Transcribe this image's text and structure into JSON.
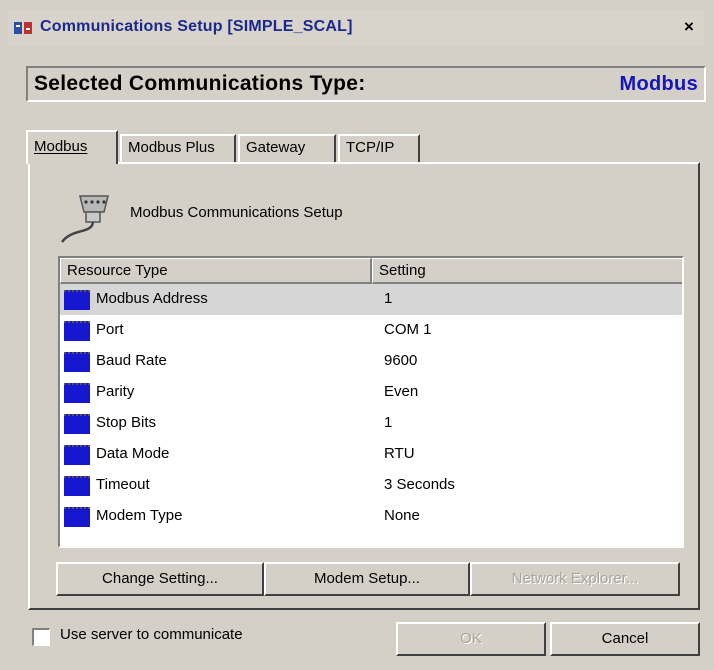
{
  "window": {
    "title": "Communications Setup [SIMPLE_SCAL]",
    "close_glyph": "×"
  },
  "selected_type": {
    "label": "Selected Communications Type:",
    "value": "Modbus",
    "value_color": "#1515b8"
  },
  "tabs": [
    {
      "label": "Modbus",
      "active": true
    },
    {
      "label": "Modbus Plus",
      "active": false
    },
    {
      "label": "Gateway",
      "active": false
    },
    {
      "label": "TCP/IP",
      "active": false
    }
  ],
  "panel": {
    "title": "Modbus Communications Setup",
    "icon": "serial-cable-icon"
  },
  "table": {
    "columns": [
      "Resource Type",
      "Setting"
    ],
    "row_icon": "chip-icon",
    "rows": [
      {
        "name": "Modbus Address",
        "value": "1",
        "selected": true
      },
      {
        "name": "Port",
        "value": "COM 1"
      },
      {
        "name": "Baud Rate",
        "value": "9600"
      },
      {
        "name": "Parity",
        "value": "Even"
      },
      {
        "name": "Stop Bits",
        "value": "1"
      },
      {
        "name": "Data Mode",
        "value": "RTU"
      },
      {
        "name": "Timeout",
        "value": "3 Seconds"
      },
      {
        "name": "Modem Type",
        "value": "None"
      }
    ]
  },
  "panel_buttons": {
    "change_setting": "Change Setting...",
    "modem_setup": "Modem Setup...",
    "network_explorer": "Network Explorer..."
  },
  "footer": {
    "checkbox_label": "Use server to communicate",
    "checkbox_checked": false,
    "ok": "OK",
    "cancel": "Cancel"
  },
  "colors": {
    "title_text": "#1b2a8a",
    "chip": "#1717d0",
    "dialog_bg": "#d4d0c8"
  }
}
